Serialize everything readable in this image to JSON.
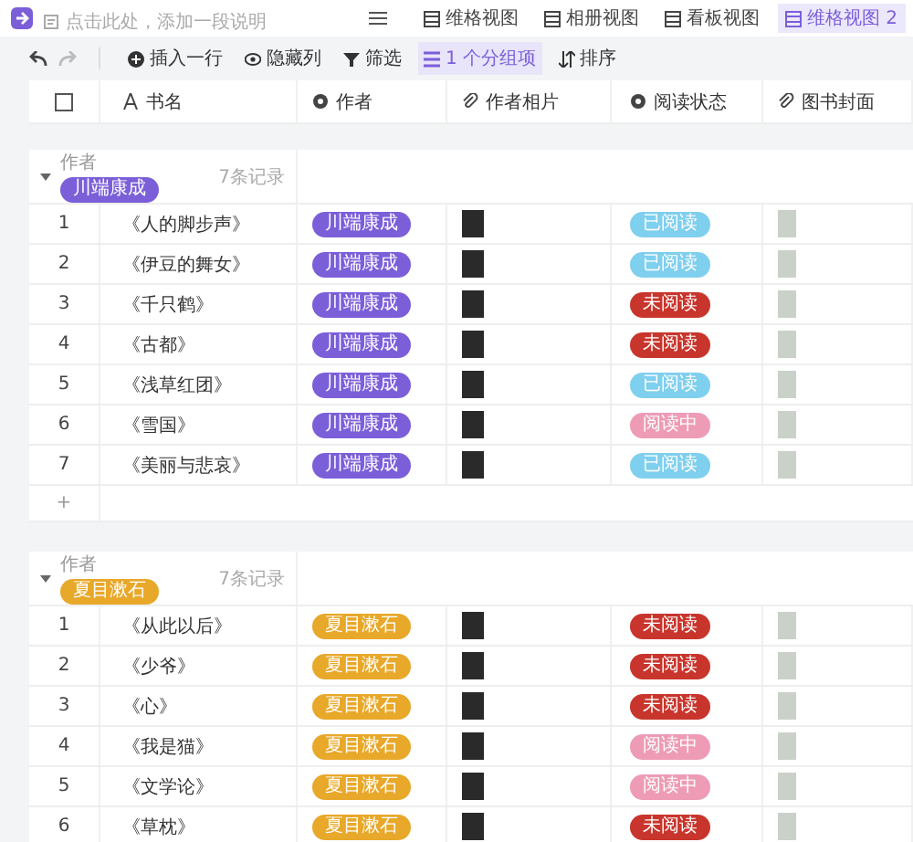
{
  "header": {
    "description": "点击此处，添加一段说明",
    "views": [
      {
        "label": "维格视图",
        "selected": false
      },
      {
        "label": "相册视图",
        "selected": false
      },
      {
        "label": "看板视图",
        "selected": false
      },
      {
        "label": "维格视图 2",
        "selected": true
      }
    ]
  },
  "toolbar": [
    {
      "label": "插入一行",
      "kind": "insert",
      "selected": false
    },
    {
      "label": "隐藏列",
      "kind": "hide",
      "selected": false
    },
    {
      "label": "筛选",
      "kind": "filter",
      "selected": false
    },
    {
      "label": "1 个分组项",
      "kind": "group",
      "selected": true
    },
    {
      "label": "排序",
      "kind": "sort",
      "selected": false
    }
  ],
  "select_all": {
    "checked": false
  },
  "columns": [
    {
      "label": "书名",
      "kind": "text"
    },
    {
      "label": "作者",
      "kind": "select"
    },
    {
      "label": "作者相片",
      "kind": "attachment"
    },
    {
      "label": "阅读状态",
      "kind": "select"
    },
    {
      "label": "图书封面",
      "kind": "attachment"
    }
  ],
  "groups": [
    {
      "field": "作者",
      "value": "川端康成",
      "color": "#7b5fd9",
      "count": "7条记录",
      "expanded": true,
      "add_row": "+",
      "rows": [
        {
          "no": "1",
          "title": "《人的脚步声》",
          "author": "川端康成",
          "status": {
            "label": "已阅读",
            "color": "#7fcfee"
          }
        },
        {
          "no": "2",
          "title": "《伊豆的舞女》",
          "author": "川端康成",
          "status": {
            "label": "已阅读",
            "color": "#7fcfee"
          }
        },
        {
          "no": "3",
          "title": "《千只鹤》",
          "author": "川端康成",
          "status": {
            "label": "未阅读",
            "color": "#c8352c"
          }
        },
        {
          "no": "4",
          "title": "《古都》",
          "author": "川端康成",
          "status": {
            "label": "未阅读",
            "color": "#c8352c"
          }
        },
        {
          "no": "5",
          "title": "《浅草红团》",
          "author": "川端康成",
          "status": {
            "label": "已阅读",
            "color": "#7fcfee"
          }
        },
        {
          "no": "6",
          "title": "《雪国》",
          "author": "川端康成",
          "status": {
            "label": "阅读中",
            "color": "#ee9bb5"
          }
        },
        {
          "no": "7",
          "title": "《美丽与悲哀》",
          "author": "川端康成",
          "status": {
            "label": "已阅读",
            "color": "#7fcfee"
          }
        }
      ]
    },
    {
      "field": "作者",
      "value": "夏目漱石",
      "color": "#e8a82a",
      "count": "7条记录",
      "expanded": true,
      "rows": [
        {
          "no": "1",
          "title": "《从此以后》",
          "author": "夏目漱石",
          "status": {
            "label": "未阅读",
            "color": "#c8352c"
          }
        },
        {
          "no": "2",
          "title": "《少爷》",
          "author": "夏目漱石",
          "status": {
            "label": "未阅读",
            "color": "#c8352c"
          }
        },
        {
          "no": "3",
          "title": "《心》",
          "author": "夏目漱石",
          "status": {
            "label": "未阅读",
            "color": "#c8352c"
          }
        },
        {
          "no": "4",
          "title": "《我是猫》",
          "author": "夏目漱石",
          "status": {
            "label": "阅读中",
            "color": "#ee9bb5"
          }
        },
        {
          "no": "5",
          "title": "《文学论》",
          "author": "夏目漱石",
          "status": {
            "label": "阅读中",
            "color": "#ee9bb5"
          }
        },
        {
          "no": "6",
          "title": "《草枕》",
          "author": "夏目漱石",
          "status": {
            "label": "未阅读",
            "color": "#c8352c"
          }
        }
      ]
    }
  ]
}
